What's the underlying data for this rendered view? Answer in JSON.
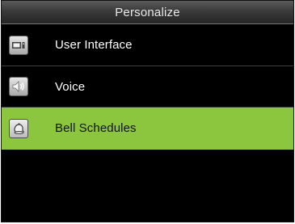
{
  "header": {
    "title": "Personalize"
  },
  "menu": {
    "items": [
      {
        "label": "User Interface",
        "icon": "display-icon",
        "selected": false
      },
      {
        "label": "Voice",
        "icon": "speaker-icon",
        "selected": false
      },
      {
        "label": "Bell Schedules",
        "icon": "bell-icon",
        "selected": true
      }
    ]
  },
  "colors": {
    "background": "#000000",
    "selection": "#8cc63f",
    "title_text": "#e9e9e9",
    "item_text": "#ffffff",
    "selected_text": "#111111"
  }
}
